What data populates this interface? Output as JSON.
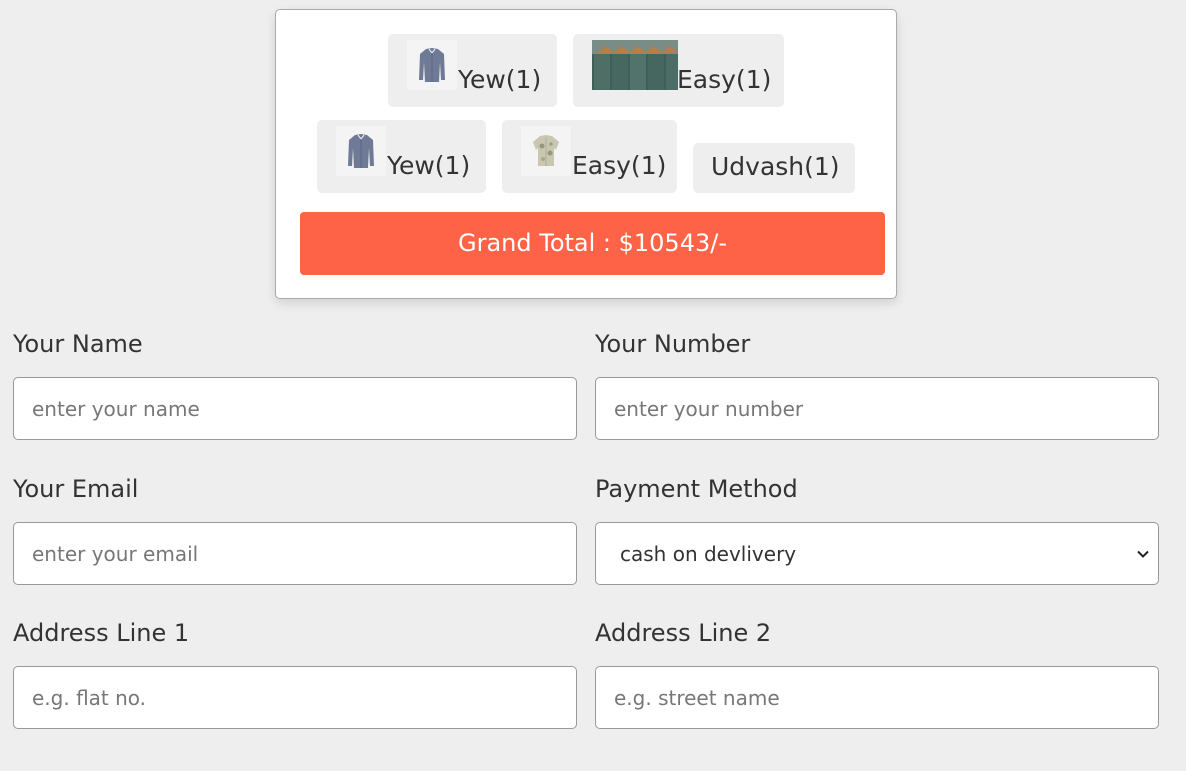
{
  "cart": {
    "items": [
      {
        "name": "Yew(1)",
        "icon": "shirt-blue-icon"
      },
      {
        "name": "Easy(1)",
        "icon": "hanging-shirts-icon"
      },
      {
        "name": "Yew(1)",
        "icon": "shirt-blue-icon"
      },
      {
        "name": "Easy(1)",
        "icon": "shirt-floral-icon"
      },
      {
        "name": "Udvash(1)"
      }
    ],
    "grand_total": "Grand Total : $10543/-"
  },
  "form": {
    "name": {
      "label": "Your Name",
      "placeholder": "enter your name"
    },
    "number": {
      "label": "Your Number",
      "placeholder": "enter your number"
    },
    "email": {
      "label": "Your Email",
      "placeholder": "enter your email"
    },
    "payment": {
      "label": "Payment Method",
      "selected": "cash on devlivery"
    },
    "address1": {
      "label": "Address Line 1",
      "placeholder": "e.g. flat no."
    },
    "address2": {
      "label": "Address Line 2",
      "placeholder": "e.g. street name"
    }
  },
  "colors": {
    "accent": "#ff6347",
    "background": "#eeeeee"
  }
}
